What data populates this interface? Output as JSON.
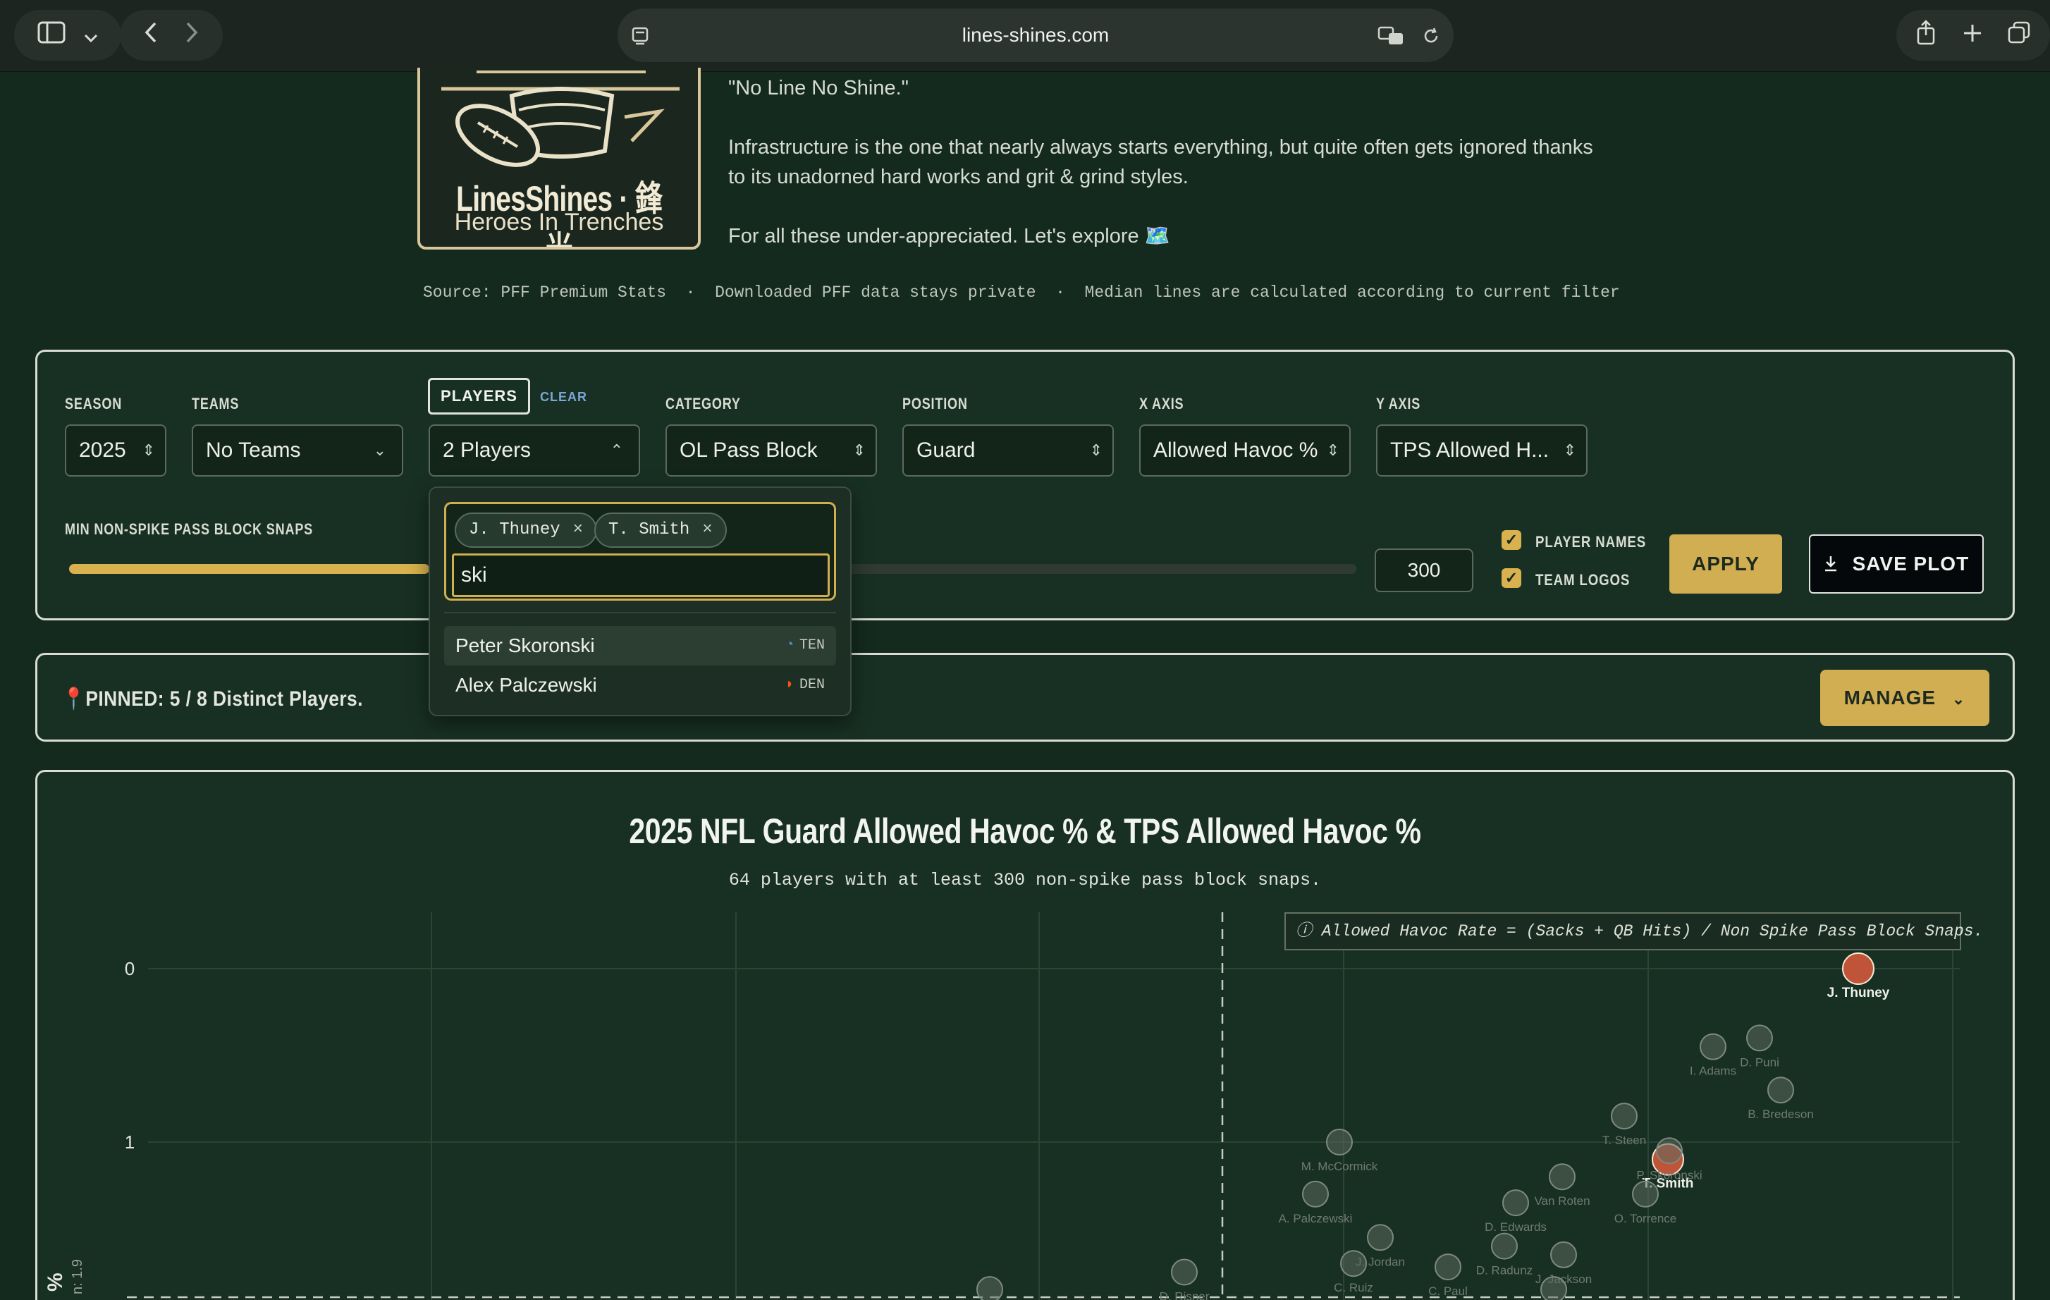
{
  "browser": {
    "url": "lines-shines.com"
  },
  "hero": {
    "logo_name": "LinesShines · 鋒光",
    "logo_tagline": "Heroes In Trenches",
    "motto": "\"No Line No Shine.\"",
    "paragraph_line1": "Infrastructure is the one that nearly always starts everything, but quite often gets ignored thanks",
    "paragraph_line2": "to its unadorned hard works and grit & grind styles.",
    "explore": "For all these under-appreciated. Let's explore 🗺️",
    "source_line": "Source: PFF Premium Stats  ·  Downloaded PFF data stays private  ·  Median lines are calculated according to current filter"
  },
  "filters": {
    "season_label": "SEASON",
    "season_value": "2025",
    "teams_label": "TEAMS",
    "teams_value": "No Teams",
    "players_label": "PLAYERS",
    "clear_label": "CLEAR",
    "players_value": "2 Players",
    "category_label": "CATEGORY",
    "category_value": "OL Pass Block",
    "position_label": "POSITION",
    "position_value": "Guard",
    "xaxis_label": "X AXIS",
    "xaxis_value": "Allowed Havoc %",
    "yaxis_label": "Y AXIS",
    "yaxis_value": "TPS Allowed H...",
    "min_snaps_label": "MIN NON-SPIKE PASS BLOCK SNAPS",
    "min_snaps_value": "300",
    "min_snaps_fill_fraction": 0.28,
    "player_names_label": "PLAYER NAMES",
    "team_logos_label": "TEAM LOGOS",
    "apply_label": "APPLY",
    "save_plot_label": "SAVE PLOT"
  },
  "players_dropdown": {
    "chips": [
      "J. Thuney",
      "T. Smith"
    ],
    "search_value": "ski",
    "options": [
      {
        "name": "Peter Skoronski",
        "team": "TEN"
      },
      {
        "name": "Alex Palczewski",
        "team": "DEN"
      }
    ]
  },
  "pinned": {
    "text": "PINNED: 5 / 8 Distinct Players.",
    "manage_label": "MANAGE"
  },
  "chart": {
    "title": "2025 NFL Guard Allowed Havoc % & TPS Allowed Havoc %",
    "subtitle": "64 players with at least 300 non-spike pass block snaps.",
    "annotation": "ⓘ Allowed Havoc Rate = (Sacks + QB Hits) / Non Spike Pass Block Snaps.",
    "y_axis_title": "%",
    "median_label": "n: 1.9"
  },
  "chart_data": {
    "type": "scatter",
    "title": "2025 NFL Guard Allowed Havoc % & TPS Allowed Havoc %",
    "subtitle": "64 players with at least 300 non-spike pass block snaps.",
    "ylabel": "%",
    "y_ticks": [
      0,
      1
    ],
    "y_reversed": true,
    "grid": true,
    "y_median": 1.9,
    "points": [
      {
        "label": "J. Thuney",
        "y": 0.0
      },
      {
        "label": "D. Puni",
        "y": 0.4
      },
      {
        "label": "I. Adams",
        "y": 0.45
      },
      {
        "label": "B. Bredeson",
        "y": 0.7
      },
      {
        "label": "T. Steen",
        "y": 0.85
      },
      {
        "label": "T. Smith",
        "y": 1.1
      },
      {
        "label": "P. Skoronski",
        "y": 1.05
      },
      {
        "label": "M. McCormick",
        "y": 1.0
      },
      {
        "label": "Van Roten",
        "y": 1.2
      },
      {
        "label": "D. Edwards",
        "y": 1.35
      },
      {
        "label": "O. Torrence",
        "y": 1.3
      },
      {
        "label": "A. Palczewski",
        "y": 1.3
      },
      {
        "label": "J. Jordan",
        "y": 1.55
      },
      {
        "label": "D. Radunz",
        "y": 1.6
      },
      {
        "label": "J. Jackson",
        "y": 1.65
      },
      {
        "label": "C. Ruiz",
        "y": 1.7
      },
      {
        "label": "C. Paul",
        "y": 1.72
      },
      {
        "label": "D. Risner",
        "y": 1.75
      },
      {
        "label": "S. Cosmi",
        "y": 1.85
      },
      {
        "label": "Z. Johnson",
        "y": 1.85
      }
    ]
  }
}
